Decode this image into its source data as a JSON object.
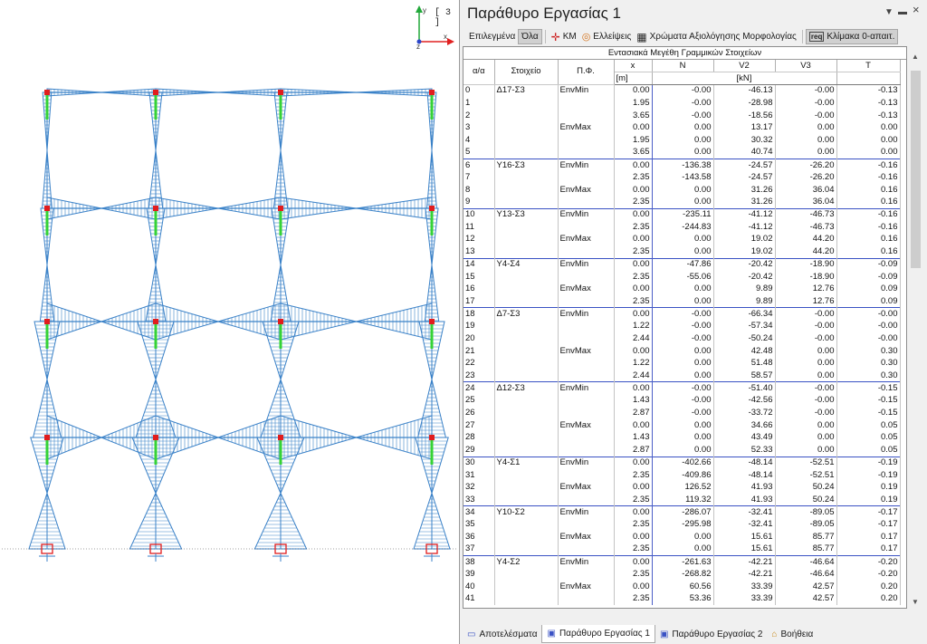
{
  "viewport": {
    "view_badge": "[ 3 ]",
    "axes": {
      "y": "y",
      "x": "x",
      "z": "z"
    }
  },
  "panel": {
    "title": "Παράθυρο Εργασίας 1",
    "header_icons": [
      "dropdown-icon",
      "pin-icon",
      "close-icon"
    ],
    "toolbar": {
      "selected_label": "Επιλεγμένα",
      "all_label": "Όλα",
      "km_label": "ΚΜ",
      "ellipses_label": "Ελλείψεις",
      "colors_label": "Χρώματα Αξιολόγησης Μορφολογίας",
      "scale_label": "Κλίμακα 0-απαιτ."
    }
  },
  "table": {
    "title": "Εντασιακά Μεγέθη Γραμμικών Στοιχείων",
    "headers": {
      "index": "α/α",
      "element": "Στοιχείο",
      "combo": "Π.Φ.",
      "x": "x",
      "N": "N",
      "V2": "V2",
      "V3": "V3",
      "T": "T"
    },
    "units": {
      "x": "[m]",
      "force": "[kN]"
    },
    "rows": [
      {
        "i": "0",
        "el": "Δ17-Σ3",
        "pf": "EnvMin",
        "x": "0.00",
        "N": "-0.00",
        "V2": "-46.13",
        "V3": "-0.00",
        "T": "-0.13"
      },
      {
        "i": "1",
        "el": "",
        "pf": "",
        "x": "1.95",
        "N": "-0.00",
        "V2": "-28.98",
        "V3": "-0.00",
        "T": "-0.13"
      },
      {
        "i": "2",
        "el": "",
        "pf": "",
        "x": "3.65",
        "N": "-0.00",
        "V2": "-18.56",
        "V3": "-0.00",
        "T": "-0.13"
      },
      {
        "i": "3",
        "el": "",
        "pf": "EnvMax",
        "x": "0.00",
        "N": "0.00",
        "V2": "13.17",
        "V3": "0.00",
        "T": "0.00"
      },
      {
        "i": "4",
        "el": "",
        "pf": "",
        "x": "1.95",
        "N": "0.00",
        "V2": "30.32",
        "V3": "0.00",
        "T": "0.00"
      },
      {
        "i": "5",
        "el": "",
        "pf": "",
        "x": "3.65",
        "N": "0.00",
        "V2": "40.74",
        "V3": "0.00",
        "T": "0.00"
      },
      {
        "i": "6",
        "el": "Υ16-Σ3",
        "pf": "EnvMin",
        "x": "0.00",
        "N": "-136.38",
        "V2": "-24.57",
        "V3": "-26.20",
        "T": "-0.16"
      },
      {
        "i": "7",
        "el": "",
        "pf": "",
        "x": "2.35",
        "N": "-143.58",
        "V2": "-24.57",
        "V3": "-26.20",
        "T": "-0.16"
      },
      {
        "i": "8",
        "el": "",
        "pf": "EnvMax",
        "x": "0.00",
        "N": "0.00",
        "V2": "31.26",
        "V3": "36.04",
        "T": "0.16"
      },
      {
        "i": "9",
        "el": "",
        "pf": "",
        "x": "2.35",
        "N": "0.00",
        "V2": "31.26",
        "V3": "36.04",
        "T": "0.16"
      },
      {
        "i": "10",
        "el": "Υ13-Σ3",
        "pf": "EnvMin",
        "x": "0.00",
        "N": "-235.11",
        "V2": "-41.12",
        "V3": "-46.73",
        "T": "-0.16"
      },
      {
        "i": "11",
        "el": "",
        "pf": "",
        "x": "2.35",
        "N": "-244.83",
        "V2": "-41.12",
        "V3": "-46.73",
        "T": "-0.16"
      },
      {
        "i": "12",
        "el": "",
        "pf": "EnvMax",
        "x": "0.00",
        "N": "0.00",
        "V2": "19.02",
        "V3": "44.20",
        "T": "0.16"
      },
      {
        "i": "13",
        "el": "",
        "pf": "",
        "x": "2.35",
        "N": "0.00",
        "V2": "19.02",
        "V3": "44.20",
        "T": "0.16"
      },
      {
        "i": "14",
        "el": "Υ4-Σ4",
        "pf": "EnvMin",
        "x": "0.00",
        "N": "-47.86",
        "V2": "-20.42",
        "V3": "-18.90",
        "T": "-0.09"
      },
      {
        "i": "15",
        "el": "",
        "pf": "",
        "x": "2.35",
        "N": "-55.06",
        "V2": "-20.42",
        "V3": "-18.90",
        "T": "-0.09"
      },
      {
        "i": "16",
        "el": "",
        "pf": "EnvMax",
        "x": "0.00",
        "N": "0.00",
        "V2": "9.89",
        "V3": "12.76",
        "T": "0.09"
      },
      {
        "i": "17",
        "el": "",
        "pf": "",
        "x": "2.35",
        "N": "0.00",
        "V2": "9.89",
        "V3": "12.76",
        "T": "0.09"
      },
      {
        "i": "18",
        "el": "Δ7-Σ3",
        "pf": "EnvMin",
        "x": "0.00",
        "N": "-0.00",
        "V2": "-66.34",
        "V3": "-0.00",
        "T": "-0.00"
      },
      {
        "i": "19",
        "el": "",
        "pf": "",
        "x": "1.22",
        "N": "-0.00",
        "V2": "-57.34",
        "V3": "-0.00",
        "T": "-0.00"
      },
      {
        "i": "20",
        "el": "",
        "pf": "",
        "x": "2.44",
        "N": "-0.00",
        "V2": "-50.24",
        "V3": "-0.00",
        "T": "-0.00"
      },
      {
        "i": "21",
        "el": "",
        "pf": "EnvMax",
        "x": "0.00",
        "N": "0.00",
        "V2": "42.48",
        "V3": "0.00",
        "T": "0.30"
      },
      {
        "i": "22",
        "el": "",
        "pf": "",
        "x": "1.22",
        "N": "0.00",
        "V2": "51.48",
        "V3": "0.00",
        "T": "0.30"
      },
      {
        "i": "23",
        "el": "",
        "pf": "",
        "x": "2.44",
        "N": "0.00",
        "V2": "58.57",
        "V3": "0.00",
        "T": "0.30"
      },
      {
        "i": "24",
        "el": "Δ12-Σ3",
        "pf": "EnvMin",
        "x": "0.00",
        "N": "-0.00",
        "V2": "-51.40",
        "V3": "-0.00",
        "T": "-0.15"
      },
      {
        "i": "25",
        "el": "",
        "pf": "",
        "x": "1.43",
        "N": "-0.00",
        "V2": "-42.56",
        "V3": "-0.00",
        "T": "-0.15"
      },
      {
        "i": "26",
        "el": "",
        "pf": "",
        "x": "2.87",
        "N": "-0.00",
        "V2": "-33.72",
        "V3": "-0.00",
        "T": "-0.15"
      },
      {
        "i": "27",
        "el": "",
        "pf": "EnvMax",
        "x": "0.00",
        "N": "0.00",
        "V2": "34.66",
        "V3": "0.00",
        "T": "0.05"
      },
      {
        "i": "28",
        "el": "",
        "pf": "",
        "x": "1.43",
        "N": "0.00",
        "V2": "43.49",
        "V3": "0.00",
        "T": "0.05"
      },
      {
        "i": "29",
        "el": "",
        "pf": "",
        "x": "2.87",
        "N": "0.00",
        "V2": "52.33",
        "V3": "0.00",
        "T": "0.05"
      },
      {
        "i": "30",
        "el": "Υ4-Σ1",
        "pf": "EnvMin",
        "x": "0.00",
        "N": "-402.66",
        "V2": "-48.14",
        "V3": "-52.51",
        "T": "-0.19"
      },
      {
        "i": "31",
        "el": "",
        "pf": "",
        "x": "2.35",
        "N": "-409.86",
        "V2": "-48.14",
        "V3": "-52.51",
        "T": "-0.19"
      },
      {
        "i": "32",
        "el": "",
        "pf": "EnvMax",
        "x": "0.00",
        "N": "126.52",
        "V2": "41.93",
        "V3": "50.24",
        "T": "0.19"
      },
      {
        "i": "33",
        "el": "",
        "pf": "",
        "x": "2.35",
        "N": "119.32",
        "V2": "41.93",
        "V3": "50.24",
        "T": "0.19"
      },
      {
        "i": "34",
        "el": "Υ10-Σ2",
        "pf": "EnvMin",
        "x": "0.00",
        "N": "-286.07",
        "V2": "-32.41",
        "V3": "-89.05",
        "T": "-0.17"
      },
      {
        "i": "35",
        "el": "",
        "pf": "",
        "x": "2.35",
        "N": "-295.98",
        "V2": "-32.41",
        "V3": "-89.05",
        "T": "-0.17"
      },
      {
        "i": "36",
        "el": "",
        "pf": "EnvMax",
        "x": "0.00",
        "N": "0.00",
        "V2": "15.61",
        "V3": "85.77",
        "T": "0.17"
      },
      {
        "i": "37",
        "el": "",
        "pf": "",
        "x": "2.35",
        "N": "0.00",
        "V2": "15.61",
        "V3": "85.77",
        "T": "0.17"
      },
      {
        "i": "38",
        "el": "Υ4-Σ2",
        "pf": "EnvMin",
        "x": "0.00",
        "N": "-261.63",
        "V2": "-42.21",
        "V3": "-46.64",
        "T": "-0.20"
      },
      {
        "i": "39",
        "el": "",
        "pf": "",
        "x": "2.35",
        "N": "-268.82",
        "V2": "-42.21",
        "V3": "-46.64",
        "T": "-0.20"
      },
      {
        "i": "40",
        "el": "",
        "pf": "EnvMax",
        "x": "0.00",
        "N": "60.56",
        "V2": "33.39",
        "V3": "42.57",
        "T": "0.20"
      },
      {
        "i": "41",
        "el": "",
        "pf": "",
        "x": "2.35",
        "N": "53.36",
        "V2": "33.39",
        "V3": "42.57",
        "T": "0.20"
      }
    ]
  },
  "tabs": [
    {
      "label": "Αποτελέσματα",
      "icon": "results-icon",
      "active": false
    },
    {
      "label": "Παράθυρο Εργασίας 1",
      "icon": "workspace-1-icon",
      "active": true
    },
    {
      "label": "Παράθυρο Εργασίας 2",
      "icon": "workspace-2-icon",
      "active": false
    },
    {
      "label": "Βοήθεια",
      "icon": "help-icon",
      "active": false
    }
  ],
  "colors": {
    "diagram": "#3b82c8",
    "column": "#35d335",
    "node": "#e11d1d",
    "accent": "#3a52c4"
  }
}
